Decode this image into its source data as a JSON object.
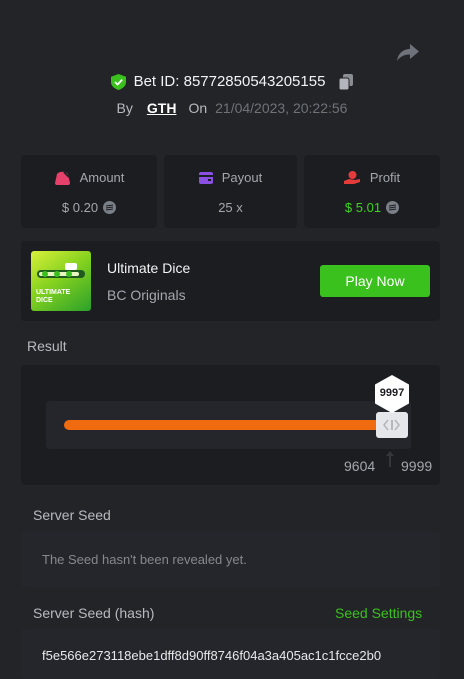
{
  "header": {
    "bet_id_label": "Bet ID: 85772850543205155",
    "by_label": "By",
    "username": "GTH",
    "on_label": "On",
    "datetime": "21/04/2023, 20:22:56"
  },
  "stats": [
    {
      "label": "Amount",
      "value": "$ 0.20",
      "icon": "bag-icon",
      "icon_color": "#e5416b"
    },
    {
      "label": "Payout",
      "value": "25 x",
      "icon": "wallet-icon",
      "icon_color": "#8a4fe3"
    },
    {
      "label": "Profit",
      "value": "$ 5.01",
      "icon": "hand-coin-icon",
      "icon_color": "#e53b3b",
      "value_color": "#3fd21f"
    }
  ],
  "game": {
    "name": "Ultimate Dice",
    "provider": "BC Originals",
    "thumb_text_line1": "ULTIMATE",
    "thumb_text_line2": "DICE",
    "play_label": "Play Now"
  },
  "result": {
    "section_label": "Result",
    "roll_value": "9997",
    "range_low": "9604",
    "range_high": "9999",
    "roll_fraction": 0.9997
  },
  "server_seed": {
    "label": "Server Seed",
    "text": "The Seed hasn't been revealed yet."
  },
  "server_seed_hash": {
    "label": "Server Seed (hash)",
    "settings_label": "Seed Settings",
    "hash": "f5e566e273118ebe1dff8d90ff8746f04a3a405ac1c1fcce2b0"
  },
  "colors": {
    "accent_green": "#3bc11d",
    "bar_orange": "#f06a0f",
    "background": "#232428",
    "panel": "#1c1d21"
  }
}
